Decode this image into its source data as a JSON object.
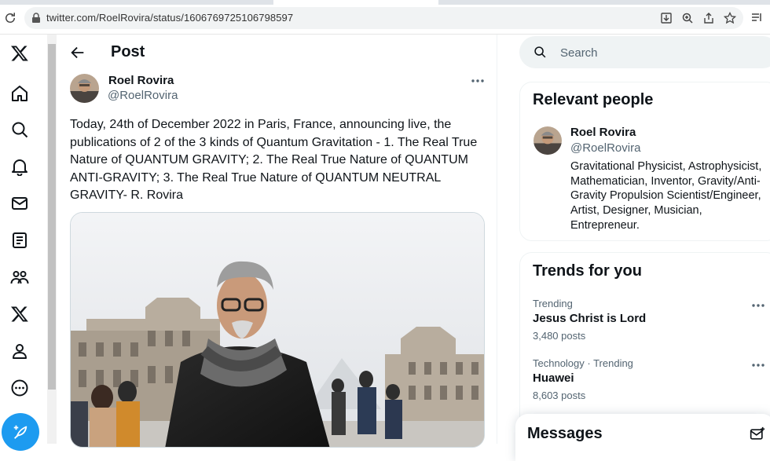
{
  "browser": {
    "url": "twitter.com/RoelRovira/status/1606769725106798597",
    "icons": [
      "reload-icon",
      "lock-icon",
      "install-icon",
      "zoom-icon",
      "share-icon",
      "bookmark-star-icon",
      "reading-list-icon"
    ]
  },
  "nav": {
    "items": [
      "x-logo-icon",
      "home-icon",
      "explore-icon",
      "notifications-icon",
      "messages-icon",
      "lists-icon",
      "communities-icon",
      "premium-icon",
      "profile-icon",
      "more-icon"
    ],
    "post_button_icon": "feather-plus-icon",
    "accent": "#1d9bf0"
  },
  "header": {
    "title": "Post"
  },
  "tweet": {
    "author_name": "Roel Rovira",
    "author_handle": "@RoelRovira",
    "text": "Today, 24th of December 2022 in Paris, France, announcing live, the publications of 2 of the 3 kinds of Quantum Gravitation - 1. The Real True Nature of QUANTUM GRAVITY; 2. The Real True Nature of QUANTUM ANTI-GRAVITY; 3. The Real True Nature of QUANTUM NEUTRAL GRAVITY- R. Rovira"
  },
  "search": {
    "placeholder": "Search"
  },
  "relevant_people": {
    "title": "Relevant people",
    "name": "Roel Rovira",
    "handle": "@RoelRovira",
    "bio": "Gravitational Physicist, Astrophysicist, Mathematician, Inventor, Gravity/Anti-Gravity Propulsion Scientist/Engineer, Artist, Designer, Musician, Entrepreneur."
  },
  "trends": {
    "title": "Trends for you",
    "items": [
      {
        "meta": "Trending",
        "name": "Jesus Christ is Lord",
        "count": "3,480 posts"
      },
      {
        "meta": "Technology · Trending",
        "name": "Huawei",
        "count": "8,603 posts"
      }
    ]
  },
  "messages": {
    "title": "Messages"
  }
}
